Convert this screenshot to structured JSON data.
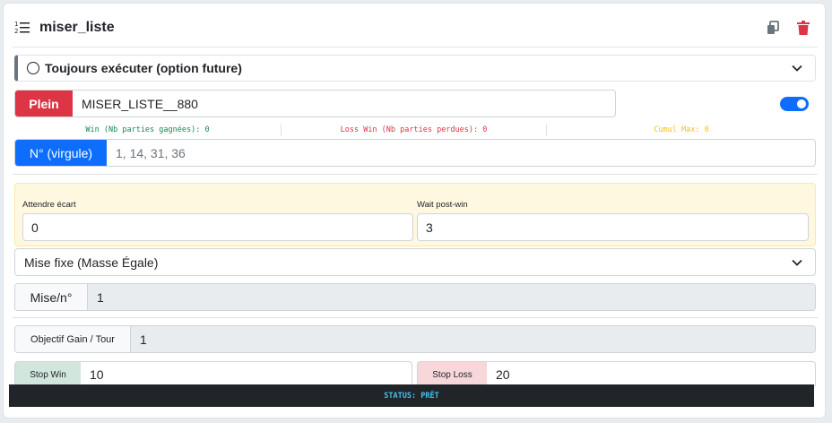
{
  "header": {
    "title": "miser_liste",
    "copy_icon": "copy-icon",
    "delete_icon": "trash-icon"
  },
  "collapse": {
    "label": "Toujours exécuter (option future)"
  },
  "plein": {
    "addon": "Plein",
    "value": "MISER_LISTE__880",
    "toggle_on": true
  },
  "stats": {
    "win": "Win (Nb parties gagnées): 0",
    "loss": "Loss Win (Nb parties perdues): 0",
    "cumul": "Cumul Max: 0"
  },
  "numbers": {
    "addon": "N° (virgule)",
    "placeholder": "1, 14, 31, 36"
  },
  "wait": {
    "attendre_label": "Attendre écart",
    "attendre_value": "0",
    "postwin_label": "Wait post-win",
    "postwin_value": "3"
  },
  "mise_mode": {
    "value": "Mise fixe (Masse Égale)"
  },
  "mise": {
    "addon": "Mise/n°",
    "value": "1"
  },
  "objectif": {
    "addon": "Objectif Gain / Tour",
    "value": "1"
  },
  "stop_win": {
    "addon": "Stop Win",
    "value": "10"
  },
  "stop_loss": {
    "addon": "Stop Loss",
    "value": "20"
  },
  "status": {
    "text": "STATUS: PRÊT"
  },
  "colors": {
    "danger": "#dc3545",
    "primary": "#0d6efd",
    "win": "#198754",
    "loss": "#dc3545",
    "cumul": "#ffc107",
    "status": "#3fc3ee"
  }
}
